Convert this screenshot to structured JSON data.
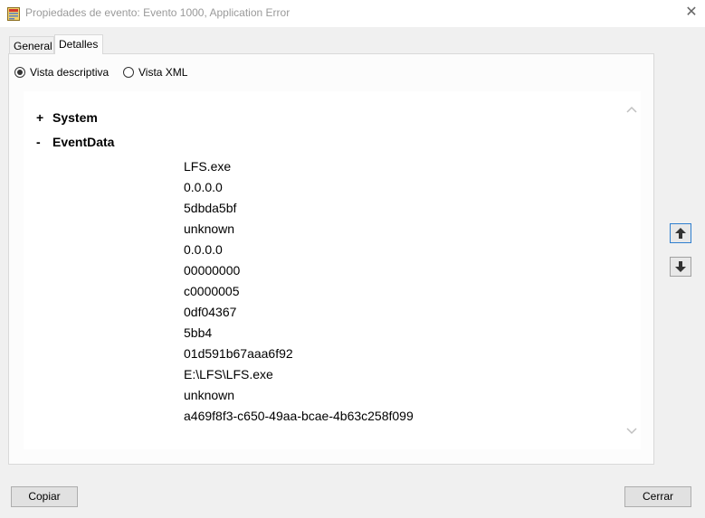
{
  "window": {
    "title": "Propiedades de evento: Evento 1000, Application Error",
    "close_glyph": "✕"
  },
  "tabs": [
    {
      "label": "General",
      "selected": false
    },
    {
      "label": "Detalles",
      "selected": true
    }
  ],
  "view_options": {
    "descriptive_label": "Vista descriptiva",
    "descriptive_checked": true,
    "xml_label": "Vista XML",
    "xml_checked": false
  },
  "tree": {
    "system": {
      "symbol": "+",
      "label": "System"
    },
    "eventdata": {
      "symbol": "-",
      "label": "EventData"
    }
  },
  "event_data": [
    "LFS.exe",
    "0.0.0.0",
    "5dbda5bf",
    "unknown",
    "0.0.0.0",
    "00000000",
    "c0000005",
    "0df04367",
    "5bb4",
    "01d591b67aaa6f92",
    "E:\\LFS\\LFS.exe",
    "unknown",
    "a469f8f3-c650-49aa-bcae-4b63c258f099"
  ],
  "buttons": {
    "copy_label": "Copiar",
    "close_label": "Cerrar"
  }
}
